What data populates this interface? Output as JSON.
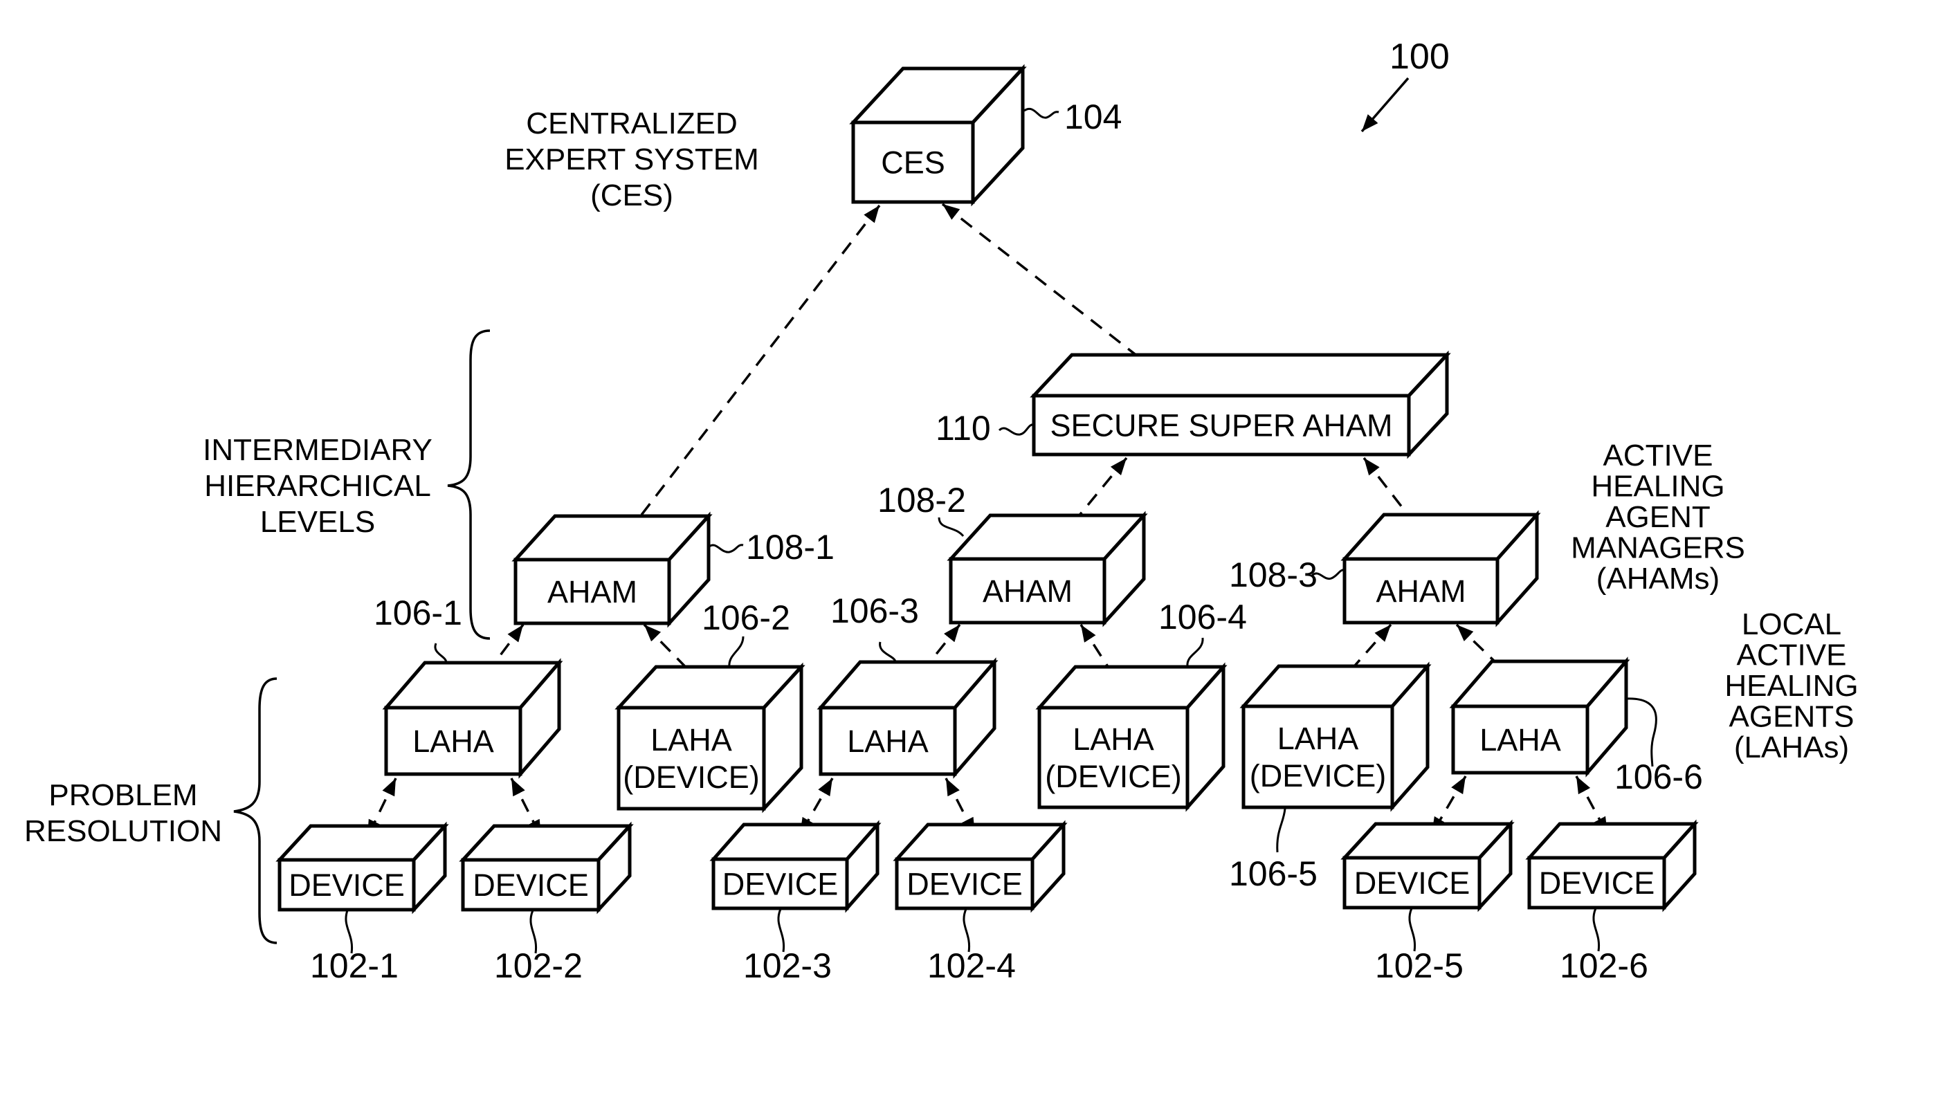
{
  "figure": {
    "number": "100"
  },
  "nodes": [
    {
      "id": "ces",
      "ref": "104",
      "lines": [
        "CES"
      ],
      "kind": "centralized-expert-system"
    },
    {
      "id": "ssa",
      "ref": "110",
      "lines": [
        "SECURE SUPER AHAM"
      ],
      "kind": "secure-super-aham"
    },
    {
      "id": "aham1",
      "ref": "108-1",
      "lines": [
        "AHAM"
      ],
      "kind": "aham"
    },
    {
      "id": "aham2",
      "ref": "108-2",
      "lines": [
        "AHAM"
      ],
      "kind": "aham"
    },
    {
      "id": "aham3",
      "ref": "108-3",
      "lines": [
        "AHAM"
      ],
      "kind": "aham"
    },
    {
      "id": "laha1",
      "ref": "106-1",
      "lines": [
        "LAHA"
      ],
      "kind": "laha"
    },
    {
      "id": "laha2",
      "ref": "106-2",
      "lines": [
        "LAHA",
        "(DEVICE)"
      ],
      "kind": "laha-device"
    },
    {
      "id": "laha3",
      "ref": "106-3",
      "lines": [
        "LAHA"
      ],
      "kind": "laha"
    },
    {
      "id": "laha4",
      "ref": "106-4",
      "lines": [
        "LAHA",
        "(DEVICE)"
      ],
      "kind": "laha-device"
    },
    {
      "id": "laha5",
      "ref": "106-5",
      "lines": [
        "LAHA",
        "(DEVICE)"
      ],
      "kind": "laha-device"
    },
    {
      "id": "laha6",
      "ref": "106-6",
      "lines": [
        "LAHA"
      ],
      "kind": "laha"
    },
    {
      "id": "dev1",
      "ref": "102-1",
      "lines": [
        "DEVICE"
      ],
      "kind": "device"
    },
    {
      "id": "dev2",
      "ref": "102-2",
      "lines": [
        "DEVICE"
      ],
      "kind": "device"
    },
    {
      "id": "dev3",
      "ref": "102-3",
      "lines": [
        "DEVICE"
      ],
      "kind": "device"
    },
    {
      "id": "dev4",
      "ref": "102-4",
      "lines": [
        "DEVICE"
      ],
      "kind": "device"
    },
    {
      "id": "dev5",
      "ref": "102-5",
      "lines": [
        "DEVICE"
      ],
      "kind": "device"
    },
    {
      "id": "dev6",
      "ref": "102-6",
      "lines": [
        "DEVICE"
      ],
      "kind": "device"
    }
  ],
  "edges": [
    {
      "from": "ces",
      "to": "aham1",
      "style": "dashed",
      "direction": "bidirectional"
    },
    {
      "from": "ces",
      "to": "ssa",
      "style": "dashed",
      "direction": "bidirectional"
    },
    {
      "from": "ssa",
      "to": "aham2",
      "style": "dashed",
      "direction": "bidirectional"
    },
    {
      "from": "ssa",
      "to": "aham3",
      "style": "dashed",
      "direction": "bidirectional"
    },
    {
      "from": "aham1",
      "to": "laha1",
      "style": "dashed",
      "direction": "bidirectional"
    },
    {
      "from": "aham1",
      "to": "laha2",
      "style": "dashed",
      "direction": "bidirectional"
    },
    {
      "from": "aham2",
      "to": "laha3",
      "style": "dashed",
      "direction": "bidirectional"
    },
    {
      "from": "aham2",
      "to": "laha4",
      "style": "dashed",
      "direction": "bidirectional"
    },
    {
      "from": "aham3",
      "to": "laha5",
      "style": "dashed",
      "direction": "bidirectional"
    },
    {
      "from": "aham3",
      "to": "laha6",
      "style": "dashed",
      "direction": "bidirectional"
    },
    {
      "from": "laha1",
      "to": "dev1",
      "style": "dashed",
      "direction": "bidirectional"
    },
    {
      "from": "laha1",
      "to": "dev2",
      "style": "dashed",
      "direction": "bidirectional"
    },
    {
      "from": "laha3",
      "to": "dev3",
      "style": "dashed",
      "direction": "bidirectional"
    },
    {
      "from": "laha3",
      "to": "dev4",
      "style": "dashed",
      "direction": "bidirectional"
    },
    {
      "from": "laha6",
      "to": "dev5",
      "style": "dashed",
      "direction": "bidirectional"
    },
    {
      "from": "laha6",
      "to": "dev6",
      "style": "dashed",
      "direction": "bidirectional"
    }
  ],
  "annotations": {
    "ces_desc": [
      "CENTRALIZED",
      "EXPERT SYSTEM",
      "(CES)"
    ],
    "intermediary": [
      "INTERMEDIARY",
      "HIERARCHICAL",
      "LEVELS"
    ],
    "problem_resolution": [
      "PROBLEM",
      "RESOLUTION"
    ],
    "ahams_desc": [
      "ACTIVE",
      "HEALING",
      "AGENT",
      "MANAGERS",
      "(AHAMs)"
    ],
    "lahas_desc": [
      "LOCAL",
      "ACTIVE",
      "HEALING",
      "AGENTS",
      "(LAHAs)"
    ]
  }
}
